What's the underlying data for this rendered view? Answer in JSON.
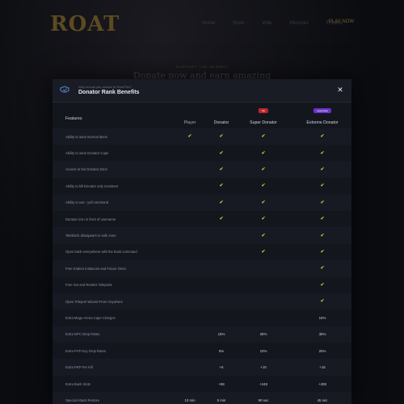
{
  "background": {
    "logo_text": "ROAT",
    "nav": [
      "Home",
      "Store",
      "Vote",
      "Hiscores",
      "Forums"
    ],
    "play_label": "PLAY NOW",
    "top_link": "",
    "eyebrow": "SUPPORT THE SERVER",
    "headline": "Donate now and earn amazing"
  },
  "modal": {
    "subtitle": "Why should you donate to Roat Pkz?",
    "title": "Donator Rank Benefits",
    "close_icon": "close-icon",
    "header_icon": "shield-icon",
    "columns": {
      "features": "Features",
      "player": "Player",
      "donator": "Donator",
      "super": "Super Donator",
      "extreme": "Extreme Donator"
    },
    "badges": {
      "super": "Vip",
      "extreme": "Legendary"
    },
    "colors": {
      "check": "#d8e838",
      "badge_red": "#c0262d",
      "badge_purple": "#6a34c9"
    },
    "rows": [
      {
        "feature": "Ability to wear Normal items",
        "player": "check",
        "donator": "check",
        "super": "check",
        "extreme": "check"
      },
      {
        "feature": "Ability to wear Donator Cape",
        "player": "",
        "donator": "check",
        "super": "check",
        "extreme": "check"
      },
      {
        "feature": "Access to the Donator Zone",
        "player": "",
        "donator": "check",
        "super": "check",
        "extreme": "check"
      },
      {
        "feature": "Ability to kill Donator only monsters",
        "player": "",
        "donator": "check",
        "super": "check",
        "extreme": "check"
      },
      {
        "feature": "Ability to use ::yell command",
        "player": "",
        "donator": "check",
        "super": "check",
        "extreme": "check"
      },
      {
        "feature": "Donator icon in front of username",
        "player": "",
        "donator": "check",
        "super": "check",
        "extreme": "check"
      },
      {
        "feature": "Teleblock dissapears in safe zone",
        "player": "",
        "donator": "",
        "super": "check",
        "extreme": "check"
      },
      {
        "feature": "Open bank everywhere with the bank command",
        "player": "",
        "donator": "",
        "super": "check",
        "extreme": "check"
      },
      {
        "feature": "Free Kraken Instances and Future Ones",
        "player": "",
        "donator": "",
        "super": "",
        "extreme": "check"
      },
      {
        "feature": "Free Set and Restrict Teleports",
        "player": "",
        "donator": "",
        "super": "",
        "extreme": "check"
      },
      {
        "feature": "Open Teleport Wizard From Anywhere",
        "player": "",
        "donator": "",
        "super": "",
        "extreme": "check"
      },
      {
        "feature": "Extra Mage Arena Cape Charges",
        "player": "",
        "donator": "",
        "super": "",
        "extreme": "15%"
      },
      {
        "feature": "Extra NPC Drop Rates",
        "player": "",
        "donator": "15%",
        "super": "25%",
        "extreme": "35%"
      },
      {
        "feature": "Extra PVP Key Drop Rates",
        "player": "",
        "donator": "5%",
        "super": "10%",
        "extreme": "25%"
      },
      {
        "feature": "Extra PKP Per Kill",
        "player": "",
        "donator": "+5",
        "super": "+10",
        "extreme": "+15"
      },
      {
        "feature": "Extra Bank Slots",
        "player": "",
        "donator": "+88",
        "super": "+248",
        "extreme": "+408"
      },
      {
        "feature": "Special Attack Restore",
        "player": "10 min",
        "donator": "5 min",
        "super": "90 sec",
        "extreme": "45 sec"
      }
    ]
  }
}
